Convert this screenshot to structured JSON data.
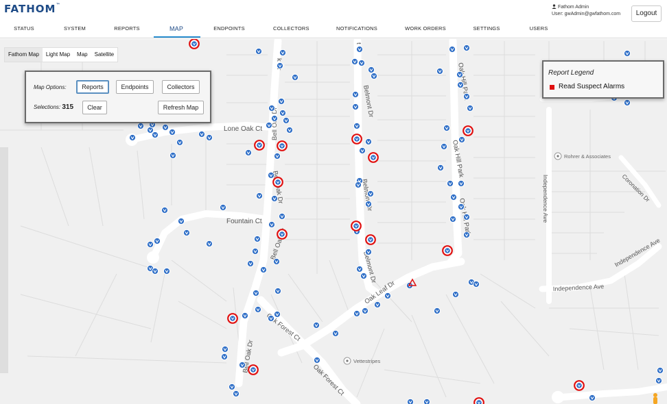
{
  "app": {
    "logo": "FATHOM",
    "logo_tm": "™"
  },
  "user": {
    "name": "Fathom Admin",
    "email": "User: gwAdmin@gwfathom.com"
  },
  "header": {
    "logout_label": "Logout"
  },
  "nav": {
    "tabs": [
      {
        "label": "STATUS"
      },
      {
        "label": "SYSTEM"
      },
      {
        "label": "REPORTS"
      },
      {
        "label": "MAP"
      },
      {
        "label": "ENDPOINTS"
      },
      {
        "label": "COLLECTORS"
      },
      {
        "label": "NOTIFICATIONS"
      },
      {
        "label": "WORK ORDERS"
      },
      {
        "label": "SETTINGS"
      },
      {
        "label": "USERS"
      }
    ],
    "active": "MAP"
  },
  "map_types": {
    "items": [
      {
        "label": "Fathom Map"
      },
      {
        "label": "Light Map"
      },
      {
        "label": "Map"
      },
      {
        "label": "Satellite"
      }
    ],
    "active": "Fathom Map"
  },
  "map_options": {
    "label": "Map Options:",
    "buttons": {
      "reports": "Reports",
      "endpoints": "Endpoints",
      "collectors": "Collectors",
      "clear": "Clear",
      "refresh": "Refresh Map"
    },
    "selections_label": "Selections:",
    "selections_count": "315",
    "active_button": "Reports"
  },
  "legend": {
    "title": "Report Legend",
    "item": "Read Suspect Alarms",
    "item_color": "#e01010"
  },
  "streets": {
    "lone_oak": "Lone Oak Ct",
    "fountain": "Fountain Ct",
    "bell_oak": "Bell Oak Dr",
    "bell_oak_trunc": "Bell Oak Dr",
    "belmont": "Belmont Dr",
    "oak_hill": "Oak Hill Park",
    "oak_forest": "Oak Forest Ct",
    "oak_leaf": "Oak Leaf Dr",
    "independence": "Independence Ave",
    "coronation": "Coronation Dr",
    "trunc_dr": "k Dr",
    "trunc_t": "t"
  },
  "pois": {
    "rohrer": "Rohrer & Associates",
    "vettestripes": "Vettestripes"
  },
  "colors": {
    "endpoint": "#2f6fc7",
    "alarm": "#e01010",
    "brand": "#1d4a86",
    "accent": "#2a8fd0"
  },
  "icons": {
    "endpoint": "meter-endpoint-icon",
    "alarm": "alarm-endpoint-icon",
    "poi": "poi-pin-icon",
    "user": "user-icon",
    "pegman": "pegman-icon"
  }
}
